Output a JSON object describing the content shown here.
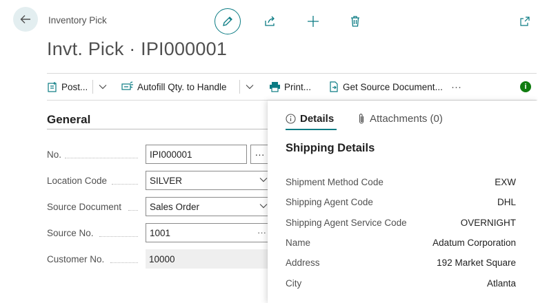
{
  "header": {
    "breadcrumb": "Inventory Pick",
    "title": "Invt. Pick · IPI000001"
  },
  "actions": {
    "post": "Post...",
    "autofill": "Autofill Qty. to Handle",
    "print": "Print...",
    "get_source": "Get Source Document...",
    "more": "···",
    "info": "i"
  },
  "general": {
    "title": "General",
    "fields": [
      {
        "label": "No.",
        "value": "IPI000001"
      },
      {
        "label": "Location Code",
        "value": "SILVER"
      },
      {
        "label": "Source Document",
        "value": "Sales Order"
      },
      {
        "label": "Source No.",
        "value": "1001"
      },
      {
        "label": "Customer No.",
        "value": "10000"
      }
    ],
    "lookup_button": "···"
  },
  "factbox": {
    "tabs": [
      {
        "label": "Details"
      },
      {
        "label": "Attachments (0)"
      }
    ],
    "heading": "Shipping Details",
    "rows": [
      {
        "label": "Shipment Method Code",
        "value": "EXW"
      },
      {
        "label": "Shipping Agent Code",
        "value": "DHL"
      },
      {
        "label": "Shipping Agent Service Code",
        "value": "OVERNIGHT"
      },
      {
        "label": "Name",
        "value": "Adatum Corporation"
      },
      {
        "label": "Address",
        "value": "192 Market Square"
      },
      {
        "label": "City",
        "value": "Atlanta"
      }
    ]
  },
  "colors": {
    "accent": "#0a7b83",
    "info_badge": "#107c10",
    "back_button_bg": "#e3eef0"
  },
  "icons": [
    "back-arrow-icon",
    "pencil-icon",
    "share-icon",
    "plus-icon",
    "trash-icon",
    "popout-icon",
    "post-icon",
    "autofill-icon",
    "printer-icon",
    "get-document-icon",
    "chevron-down-icon",
    "info-icon",
    "paperclip-icon"
  ]
}
